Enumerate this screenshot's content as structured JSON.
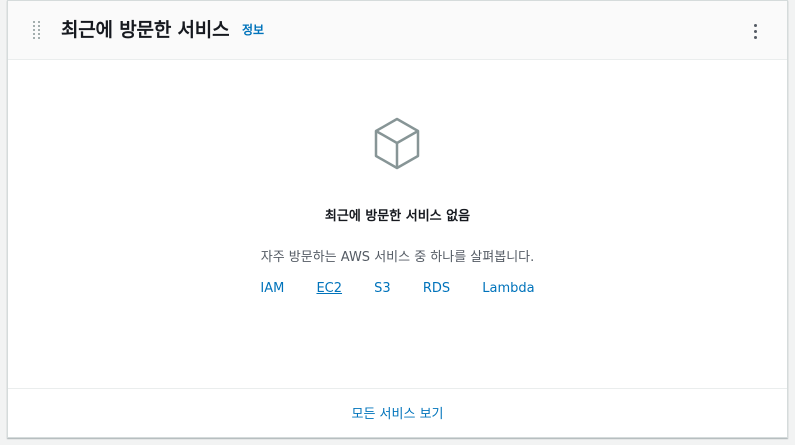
{
  "widget": {
    "title": "최근에 방문한 서비스",
    "info_link": "정보"
  },
  "empty_state": {
    "icon": "cube-icon",
    "title": "최근에 방문한 서비스 없음",
    "description": "자주 방문하는 AWS 서비스 중 하나를 살펴봅니다."
  },
  "services": [
    "IAM",
    "EC2",
    "S3",
    "RDS",
    "Lambda"
  ],
  "footer": {
    "link": "모든 서비스 보기"
  },
  "colors": {
    "link": "#0073bb",
    "icon": "#879596"
  }
}
